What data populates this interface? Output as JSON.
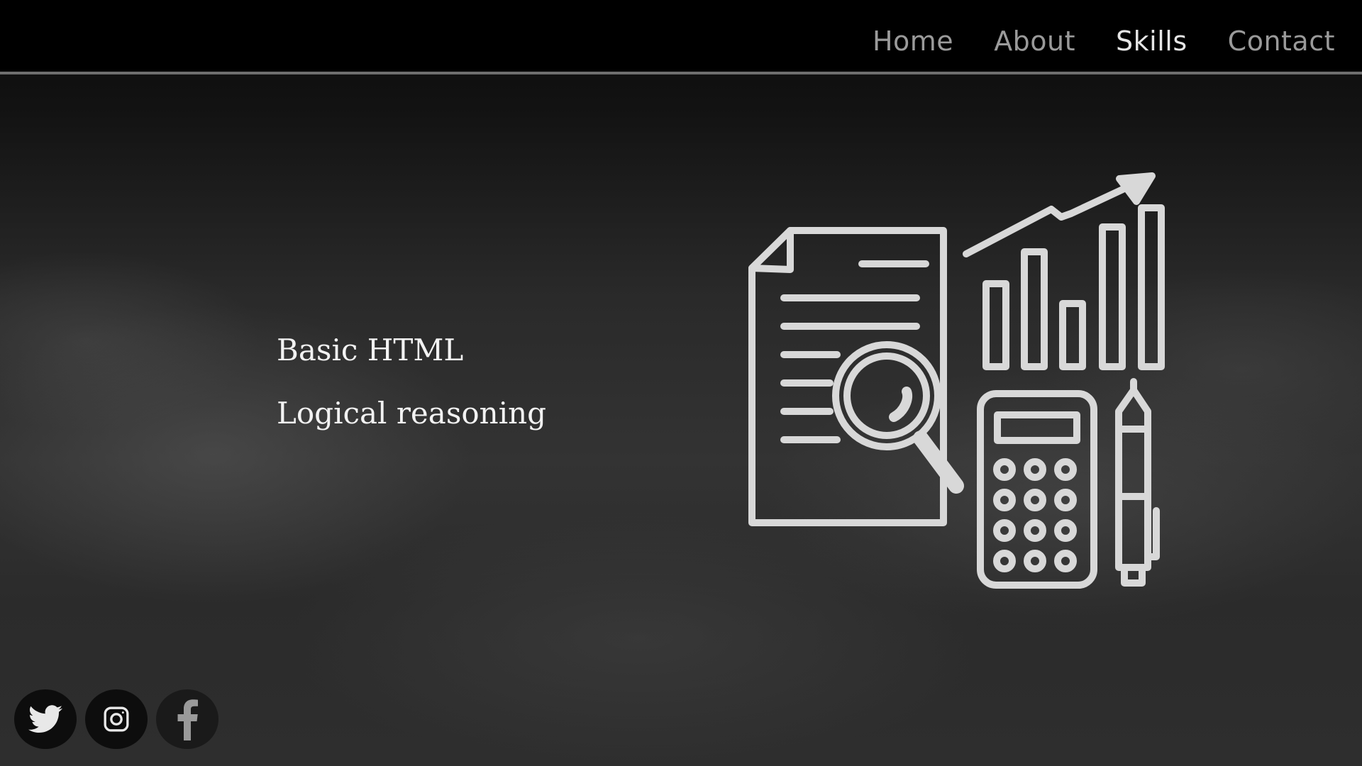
{
  "nav": {
    "links": [
      "Home",
      "About",
      "Skills",
      "Contact"
    ],
    "active": "Skills"
  },
  "skills": {
    "items": [
      "Basic HTML",
      "Logical reasoning"
    ]
  },
  "illustration": {
    "icon": "data-analysis-icon",
    "stroke_color": "#d8d8d8"
  },
  "social": {
    "icons": [
      "twitter-icon",
      "instagram-icon",
      "facebook-icon"
    ]
  },
  "colors": {
    "nav_background": "#000000",
    "nav_text": "#9a9a9a",
    "nav_active": "#e6e6e6",
    "page_background": "#2a2a2a",
    "text": "#f2f2f2"
  }
}
